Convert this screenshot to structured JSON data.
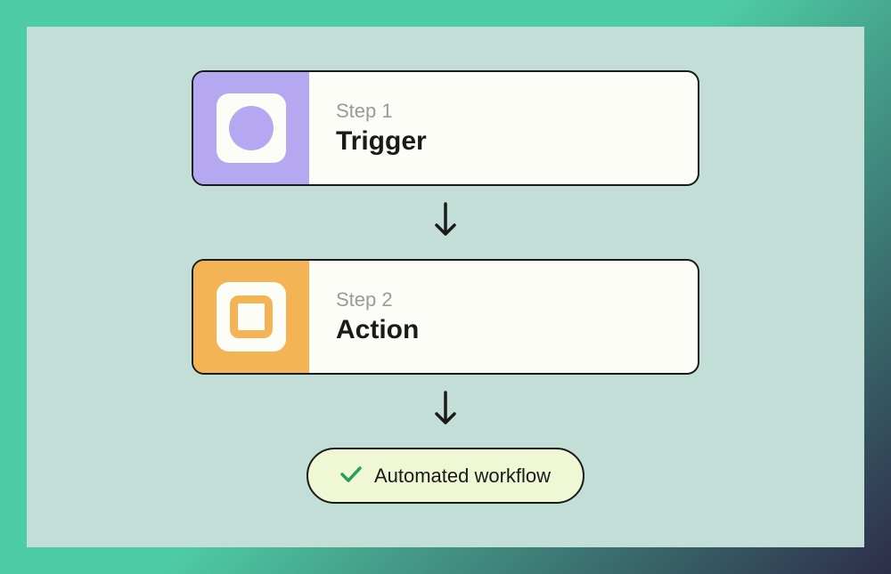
{
  "steps": [
    {
      "label": "Step 1",
      "title": "Trigger",
      "icon": "circle-icon",
      "color": "trigger"
    },
    {
      "label": "Step 2",
      "title": "Action",
      "icon": "square-icon",
      "color": "action"
    }
  ],
  "result": {
    "text": "Automated workflow"
  }
}
